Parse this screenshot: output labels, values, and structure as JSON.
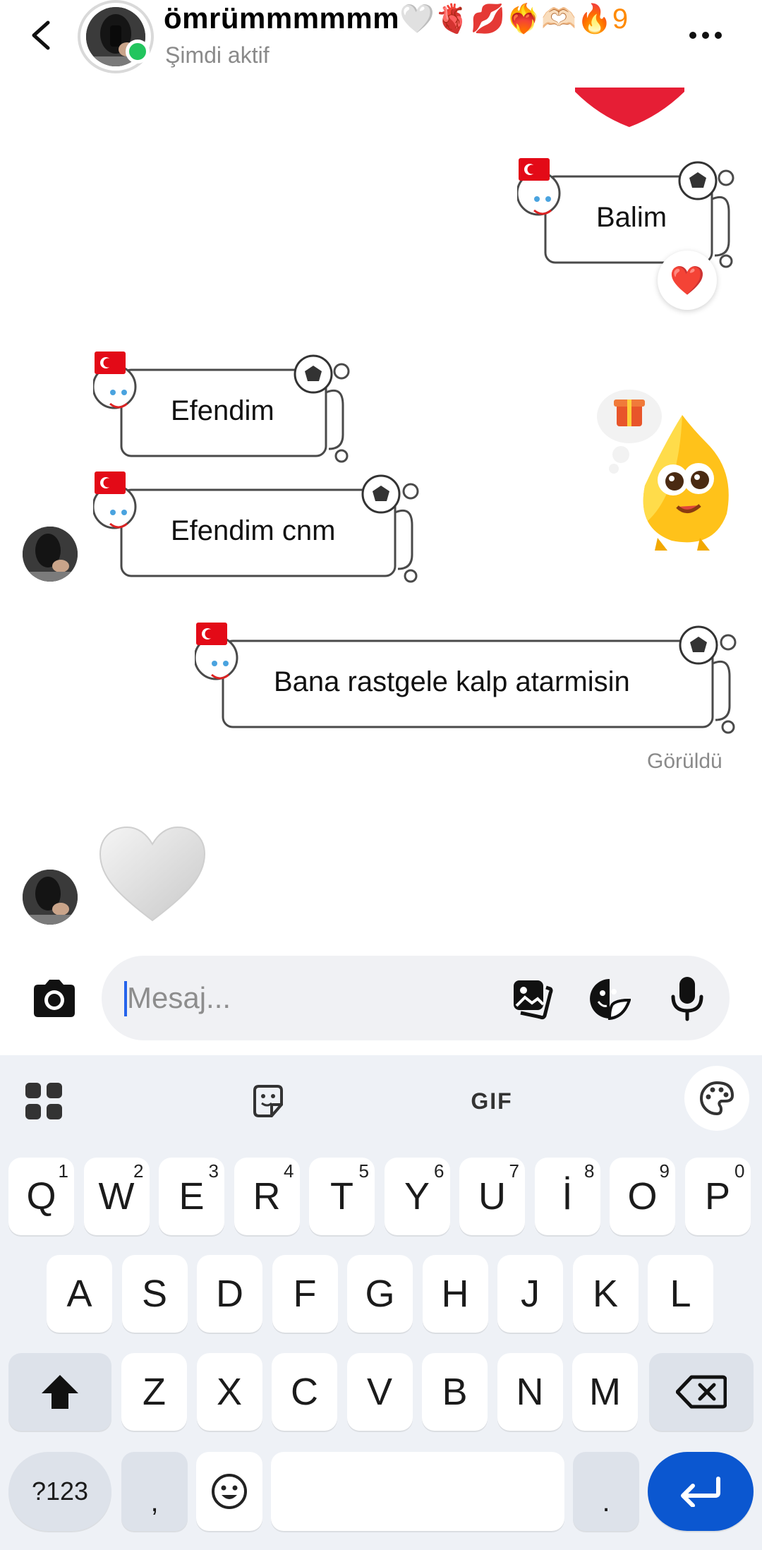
{
  "header": {
    "name": "ömrümmmmmm",
    "name_emojis": "🤍🫀💋❤️‍🔥🫶🏻🔥",
    "streak": "9",
    "status": "Şimdi aktif"
  },
  "messages": [
    {
      "side": "out",
      "text": "Balim",
      "reaction": "❤️"
    },
    {
      "side": "in",
      "text": "Efendim"
    },
    {
      "side": "in",
      "text": "Efendim cnm"
    },
    {
      "side": "out",
      "text": "Bana rastgele kalp atarmisin"
    },
    {
      "side": "in",
      "text": "🤍"
    }
  ],
  "seen_label": "Görüldü",
  "composer": {
    "placeholder": "Mesaj..."
  },
  "keyboard": {
    "toolbar": [
      "grid",
      "sticker",
      "GIF",
      "palette"
    ],
    "gif_label": "GIF",
    "row1": [
      {
        "k": "Q",
        "h": "1"
      },
      {
        "k": "W",
        "h": "2"
      },
      {
        "k": "E",
        "h": "3"
      },
      {
        "k": "R",
        "h": "4"
      },
      {
        "k": "T",
        "h": "5"
      },
      {
        "k": "Y",
        "h": "6"
      },
      {
        "k": "U",
        "h": "7"
      },
      {
        "k": "İ",
        "h": "8"
      },
      {
        "k": "O",
        "h": "9"
      },
      {
        "k": "P",
        "h": "0"
      }
    ],
    "row2": [
      "A",
      "S",
      "D",
      "F",
      "G",
      "H",
      "J",
      "K",
      "L"
    ],
    "row3": [
      "Z",
      "X",
      "C",
      "V",
      "B",
      "N",
      "M"
    ],
    "sym": "?123",
    "comma": ",",
    "period": "."
  },
  "colors": {
    "accent": "#0b57d0",
    "online": "#22c55e",
    "keyboard_bg": "#eef1f6",
    "bubble_border": "#555555"
  }
}
